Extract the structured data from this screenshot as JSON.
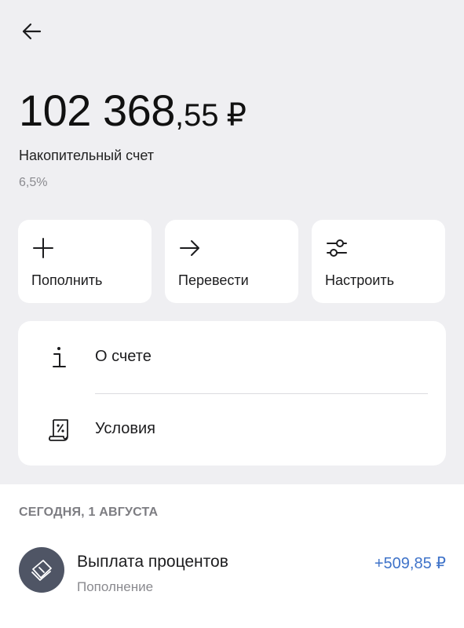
{
  "header": {
    "back_icon": "arrow-left-icon"
  },
  "account": {
    "balance_int": "102 368",
    "balance_frac": ",55",
    "currency": "₽",
    "name": "Накопительный счет",
    "rate": "6,5%"
  },
  "actions": [
    {
      "label": "Пополнить",
      "icon": "plus-icon"
    },
    {
      "label": "Перевести",
      "icon": "arrow-right-icon"
    },
    {
      "label": "Настроить",
      "icon": "sliders-icon"
    }
  ],
  "info": [
    {
      "label": "О счете",
      "icon": "info-icon"
    },
    {
      "label": "Условия",
      "icon": "percent-document-icon"
    }
  ],
  "history": {
    "date_header": "СЕГОДНЯ, 1 АВГУСТА",
    "transactions": [
      {
        "title": "Выплата процентов",
        "subtitle": "Пополнение",
        "amount": "+509,85 ₽",
        "icon": "banknotes-icon",
        "amount_color": "#3f73c9"
      }
    ]
  },
  "colors": {
    "background": "#efeff2",
    "card": "#ffffff",
    "accent": "#3f73c9",
    "avatar": "#4f5565"
  }
}
